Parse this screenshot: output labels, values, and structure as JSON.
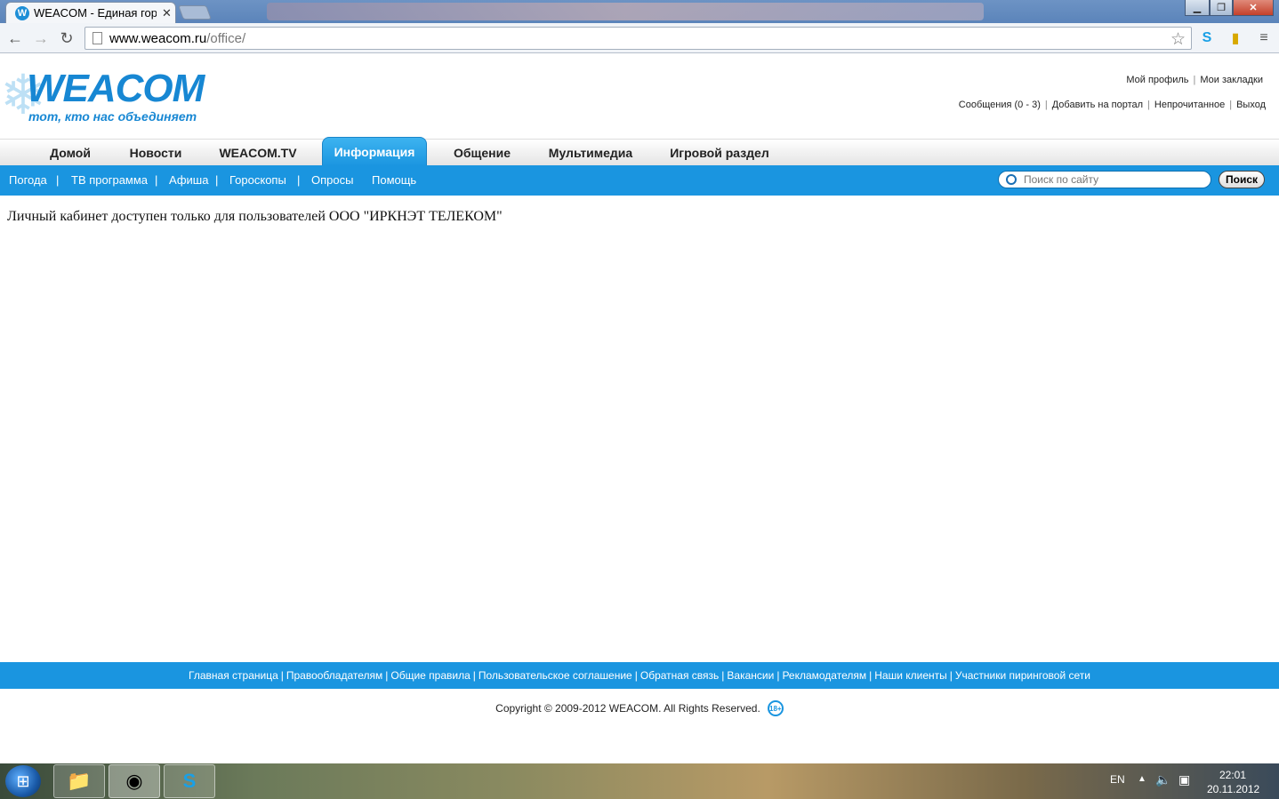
{
  "browser": {
    "tab_title": "WEACOM - Единая город",
    "tab_favicon": "W",
    "url_host": "www.weacom.ru",
    "url_path": "/office/"
  },
  "header": {
    "logo_text": "WEACOM",
    "logo_slogan": "тот, кто нас объединяет",
    "top_links_row1": [
      "Мой профиль",
      "Мои закладки"
    ],
    "top_links_row2": [
      "Сообщения (0 - 3)",
      "Добавить на портал",
      "Непрочитанное",
      "Выход"
    ]
  },
  "main_nav": {
    "items": [
      "Домой",
      "Новости",
      "WEACOM.TV",
      "Информация",
      "Общение",
      "Мультимедиа",
      "Игровой раздел"
    ],
    "active": "Информация"
  },
  "sub_nav": {
    "items": [
      "Погода",
      "ТВ программа",
      "Афиша",
      "Гороскопы",
      "Опросы",
      "Помощь"
    ],
    "search_placeholder": "Поиск по сайту",
    "search_button": "Поиск"
  },
  "content": {
    "notice": "Личный кабинет доступен только для пользователей ООО \"ИРКНЭТ ТЕЛЕКОМ\""
  },
  "footer": {
    "links": [
      "Главная страница",
      "Правообладателям",
      "Общие правила",
      "Пользовательское соглашение",
      "Обратная связь",
      "Вакансии",
      "Рекламодателям",
      "Наши клиенты",
      "Участники пиринговой сети"
    ],
    "copyright": "Copyright © 2009-2012 WEACOM. All Rights Reserved.",
    "age_badge": "18+"
  },
  "taskbar": {
    "lang": "EN",
    "time": "22:01",
    "date": "20.11.2012"
  },
  "colors": {
    "accent": "#1a95e0",
    "logo": "#1787d3"
  }
}
